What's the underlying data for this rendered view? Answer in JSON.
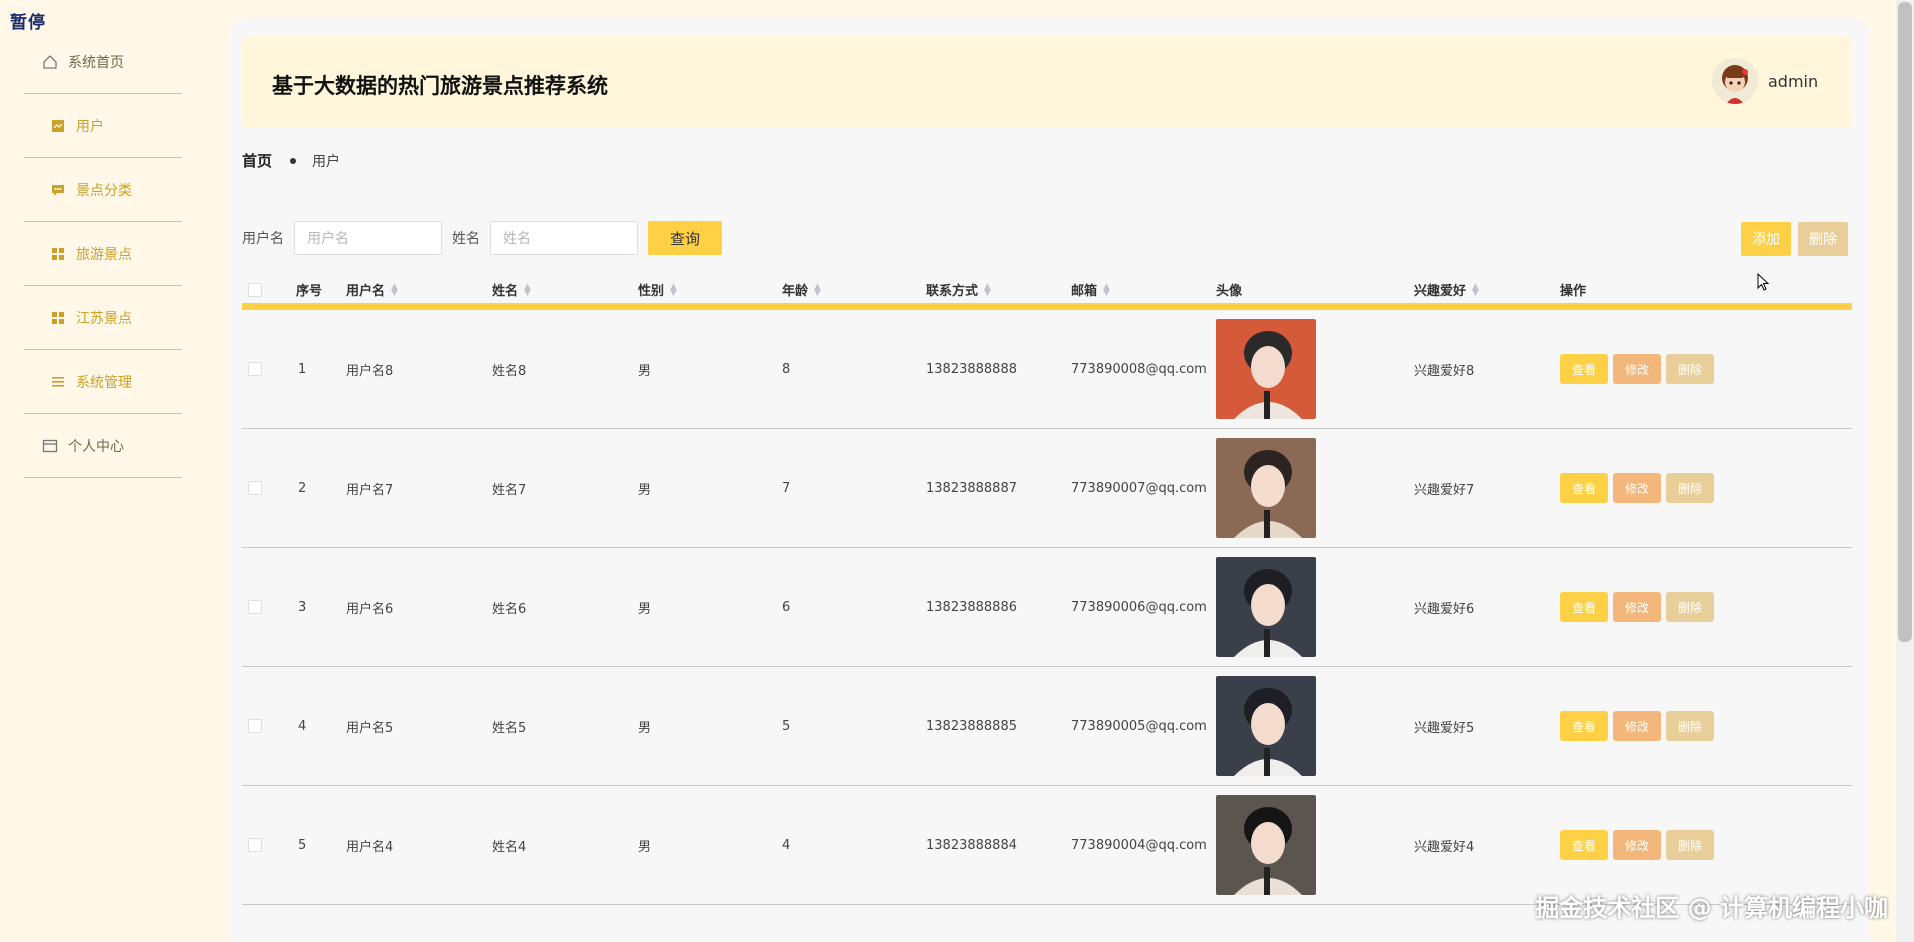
{
  "overlay": {
    "pause_label": "暂停"
  },
  "sidebar": {
    "items": [
      {
        "label": "系统首页",
        "icon": "home-icon"
      },
      {
        "label": "用户",
        "icon": "user-icon"
      },
      {
        "label": "景点分类",
        "icon": "category-icon"
      },
      {
        "label": "旅游景点",
        "icon": "grid-icon"
      },
      {
        "label": "江苏景点",
        "icon": "grid-icon"
      },
      {
        "label": "系统管理",
        "icon": "menu-icon"
      },
      {
        "label": "个人中心",
        "icon": "card-icon"
      }
    ]
  },
  "header": {
    "title": "基于大数据的热门旅游景点推荐系统",
    "user": "admin"
  },
  "breadcrumb": {
    "home": "首页",
    "current": "用户"
  },
  "filters": {
    "username_label": "用户名",
    "username_placeholder": "用户名",
    "name_label": "姓名",
    "name_placeholder": "姓名",
    "query_label": "查询"
  },
  "actions": {
    "add_label": "添加",
    "delete_label": "删除"
  },
  "table": {
    "headers": {
      "index": "序号",
      "username": "用户名",
      "name": "姓名",
      "gender": "性别",
      "age": "年龄",
      "phone": "联系方式",
      "email": "邮箱",
      "avatar": "头像",
      "hobby": "兴趣爱好",
      "ops": "操作"
    },
    "rows": [
      {
        "index": "1",
        "username": "用户名8",
        "name": "姓名8",
        "gender": "男",
        "age": "8",
        "phone": "13823888888",
        "email": "773890008@qq.com",
        "hobby": "兴趣爱好8"
      },
      {
        "index": "2",
        "username": "用户名7",
        "name": "姓名7",
        "gender": "男",
        "age": "7",
        "phone": "13823888887",
        "email": "773890007@qq.com",
        "hobby": "兴趣爱好7"
      },
      {
        "index": "3",
        "username": "用户名6",
        "name": "姓名6",
        "gender": "男",
        "age": "6",
        "phone": "13823888886",
        "email": "773890006@qq.com",
        "hobby": "兴趣爱好6"
      },
      {
        "index": "4",
        "username": "用户名5",
        "name": "姓名5",
        "gender": "男",
        "age": "5",
        "phone": "13823888885",
        "email": "773890005@qq.com",
        "hobby": "兴趣爱好5"
      },
      {
        "index": "5",
        "username": "用户名4",
        "name": "姓名4",
        "gender": "男",
        "age": "4",
        "phone": "13823888884",
        "email": "773890004@qq.com",
        "hobby": "兴趣爱好4"
      }
    ],
    "row_ops": {
      "view": "查看",
      "edit": "修改",
      "delete": "删除"
    }
  },
  "watermark": "掘金技术社区 @ 计算机编程小咖",
  "colors": {
    "accent": "#fdd046",
    "edit": "#f3b77b",
    "delete": "#e8cf9a",
    "sidebar_bg": "#fff8e8"
  }
}
